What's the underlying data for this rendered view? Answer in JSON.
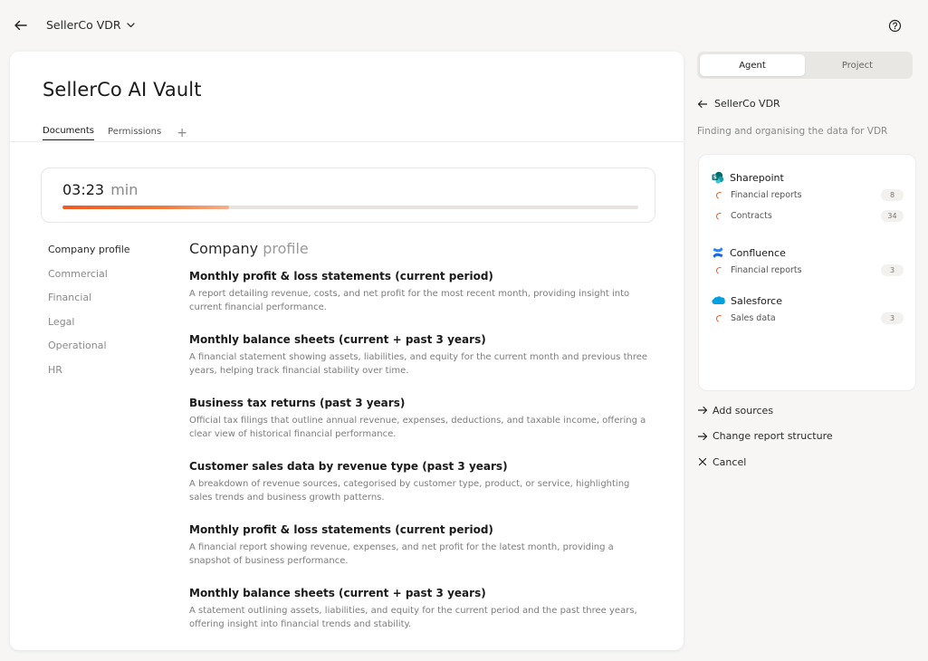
{
  "header": {
    "vdr_name": "SellerCo VDR"
  },
  "vault": {
    "title": "SellerCo AI Vault",
    "tabs": [
      {
        "label": "Documents"
      },
      {
        "label": "Permissions"
      }
    ],
    "add_tab_label": "+"
  },
  "timer": {
    "time": "03:23",
    "unit": "min",
    "progress": 0.29
  },
  "categories": [
    {
      "label": "Company profile"
    },
    {
      "label": "Commercial"
    },
    {
      "label": "Financial"
    },
    {
      "label": "Legal"
    },
    {
      "label": "Operational"
    },
    {
      "label": "HR"
    }
  ],
  "section": {
    "title_main": "Company ",
    "title_fade": "profile"
  },
  "documents": [
    {
      "title": "Monthly profit & loss statements (current period)",
      "desc": "A report detailing revenue, costs, and net profit for the most recent month, providing insight into current financial performance."
    },
    {
      "title": "Monthly balance sheets (current + past 3 years)",
      "desc": "A financial statement showing assets, liabilities, and equity for the current month and previous three years, helping track financial stability over time."
    },
    {
      "title": "Business tax returns (past 3 years)",
      "desc": "Official tax filings that outline annual revenue, expenses, deductions, and taxable income, offering a clear view of historical financial performance."
    },
    {
      "title": "Customer sales data by revenue type (past 3 years)",
      "desc": "A breakdown of revenue sources, categorised by customer type, product, or service, highlighting sales trends and business growth patterns."
    },
    {
      "title": "Monthly profit & loss statements (current period)",
      "desc": "A financial report showing revenue, expenses, and net profit for the latest month, providing a snapshot of business performance."
    },
    {
      "title": "Monthly balance sheets (current + past 3 years)",
      "desc": "A statement outlining assets, liabilities, and equity for the current period and the past three years, offering insight into financial trends and stability."
    }
  ],
  "panel": {
    "tabs": [
      {
        "label": "Agent"
      },
      {
        "label": "Project"
      }
    ],
    "back_label": "SellerCo VDR",
    "subtitle": "Finding and organising the data for VDR",
    "sources": [
      {
        "name": "Sharepoint",
        "icon": "sharepoint-icon",
        "rows": [
          {
            "label": "Financial reports",
            "count": "8"
          },
          {
            "label": "Contracts",
            "count": "34"
          }
        ]
      },
      {
        "name": "Confluence",
        "icon": "confluence-icon",
        "rows": [
          {
            "label": "Financial reports",
            "count": "3"
          }
        ]
      },
      {
        "name": "Salesforce",
        "icon": "salesforce-icon",
        "rows": [
          {
            "label": "Sales data",
            "count": "3"
          }
        ]
      }
    ],
    "actions": [
      {
        "label": "Add sources",
        "icon": "arrow-right-icon"
      },
      {
        "label": "Change report structure",
        "icon": "arrow-right-icon"
      },
      {
        "label": "Cancel",
        "icon": "close-icon"
      }
    ]
  },
  "colors": {
    "accent": "#ee5a24",
    "sharepoint": "#0b7a8a",
    "confluence": "#1868db",
    "salesforce": "#00a1e0"
  }
}
